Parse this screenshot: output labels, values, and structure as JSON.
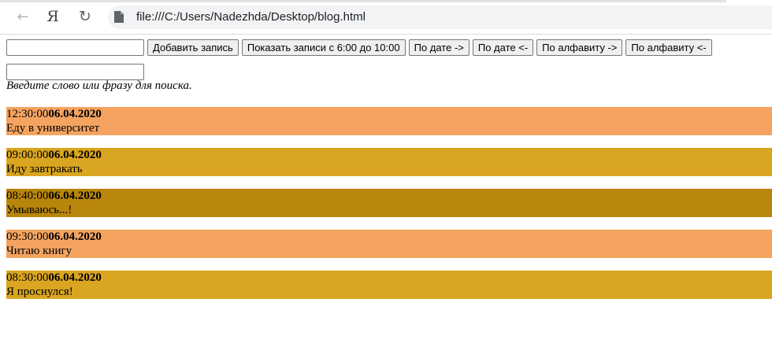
{
  "browser": {
    "ya_label": "Я",
    "url": "file:///C:/Users/Nadezhda/Desktop/blog.html"
  },
  "controls": {
    "entry_input_value": "",
    "add_button": "Добавить запись",
    "show_morning_button": "Показать записи с 6:00 до 10:00",
    "date_asc_button": "По дате ->",
    "date_desc_button": "По дате <-",
    "alpha_asc_button": "По алфавиту ->",
    "alpha_desc_button": "По алфавиту <-",
    "search_input_value": "",
    "search_hint": "Введите слово или фразу для поиска."
  },
  "colors": {
    "salmon": "#f4a460",
    "goldenrod": "#daa520",
    "darkgoldenrod": "#b8860b"
  },
  "posts": [
    {
      "time": "12:30:00",
      "date": "06.04.2020",
      "text": "Еду в университет",
      "color": "#f4a460"
    },
    {
      "time": "09:00:00",
      "date": "06.04.2020",
      "text": "Иду завтракать",
      "color": "#daa520"
    },
    {
      "time": "08:40:00",
      "date": "06.04.2020",
      "text": "Умываюсь...!",
      "color": "#b8860b"
    },
    {
      "time": "09:30:00",
      "date": "06.04.2020",
      "text": "Читаю книгу",
      "color": "#f4a460"
    },
    {
      "time": "08:30:00",
      "date": "06.04.2020",
      "text": "Я проснулся!",
      "color": "#daa520"
    }
  ]
}
